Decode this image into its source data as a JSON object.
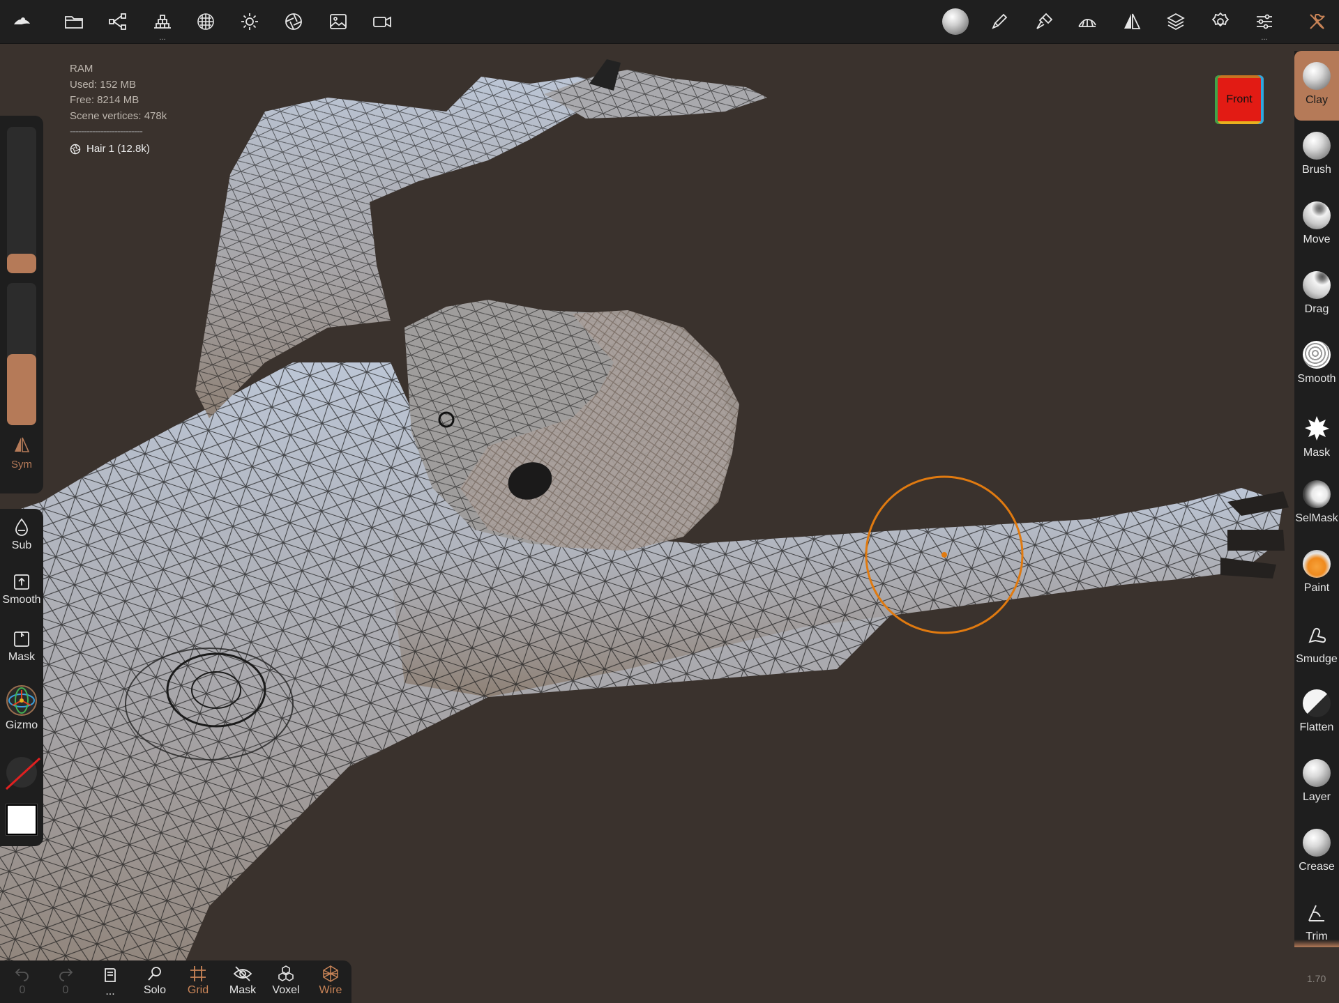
{
  "topbar": {
    "left_icons": [
      "nomad-logo-icon",
      "folder-icon",
      "scene-tree-icon",
      "primitives-icon",
      "material-icon",
      "light-icon",
      "shading-icon",
      "background-image-icon",
      "video-record-icon"
    ],
    "right_icons": [
      "matcap-sphere-icon",
      "stroke-brush-icon",
      "paint-tool-icon",
      "topology-icon",
      "symmetry-icon",
      "layers-icon",
      "settings-icon",
      "sliders-icon",
      "tools-icon"
    ],
    "more_indicator": "..."
  },
  "stats": {
    "ram_label": "RAM",
    "used": "Used: 152 MB",
    "free": "Free: 8214 MB",
    "vertices": "Scene vertices: 478k",
    "separator": "--------------------------",
    "object": "Hair 1 (12.8k)"
  },
  "view_cube": {
    "label": "Front"
  },
  "left_panel": {
    "sliders": [
      {
        "name": "radius",
        "value": 0.12
      },
      {
        "name": "intensity",
        "value": 0.5
      }
    ],
    "sym_label": "Sym",
    "items": [
      {
        "name": "sub",
        "label": "Sub"
      },
      {
        "name": "smooth",
        "label": "Smooth"
      },
      {
        "name": "mask",
        "label": "Mask"
      },
      {
        "name": "gizmo",
        "label": "Gizmo"
      }
    ]
  },
  "tools": [
    {
      "label": "Clay",
      "active": true
    },
    {
      "label": "Brush"
    },
    {
      "label": "Move"
    },
    {
      "label": "Drag"
    },
    {
      "label": "Smooth"
    },
    {
      "label": "Mask"
    },
    {
      "label": "SelMask"
    },
    {
      "label": "Paint"
    },
    {
      "label": "Smudge"
    },
    {
      "label": "Flatten"
    },
    {
      "label": "Layer"
    },
    {
      "label": "Crease"
    },
    {
      "label": "Trim"
    }
  ],
  "version": "1.70",
  "bottom_bar": {
    "undo_count": "0",
    "redo_count": "0",
    "more_label": "...",
    "solo": "Solo",
    "grid": "Grid",
    "mask": "Mask",
    "voxel": "Voxel",
    "wire": "Wire"
  },
  "colors": {
    "accent": "#b57a58",
    "background": "#3a322d",
    "toolbar": "#1f1f1f",
    "brush_cursor": "#e07a10"
  }
}
